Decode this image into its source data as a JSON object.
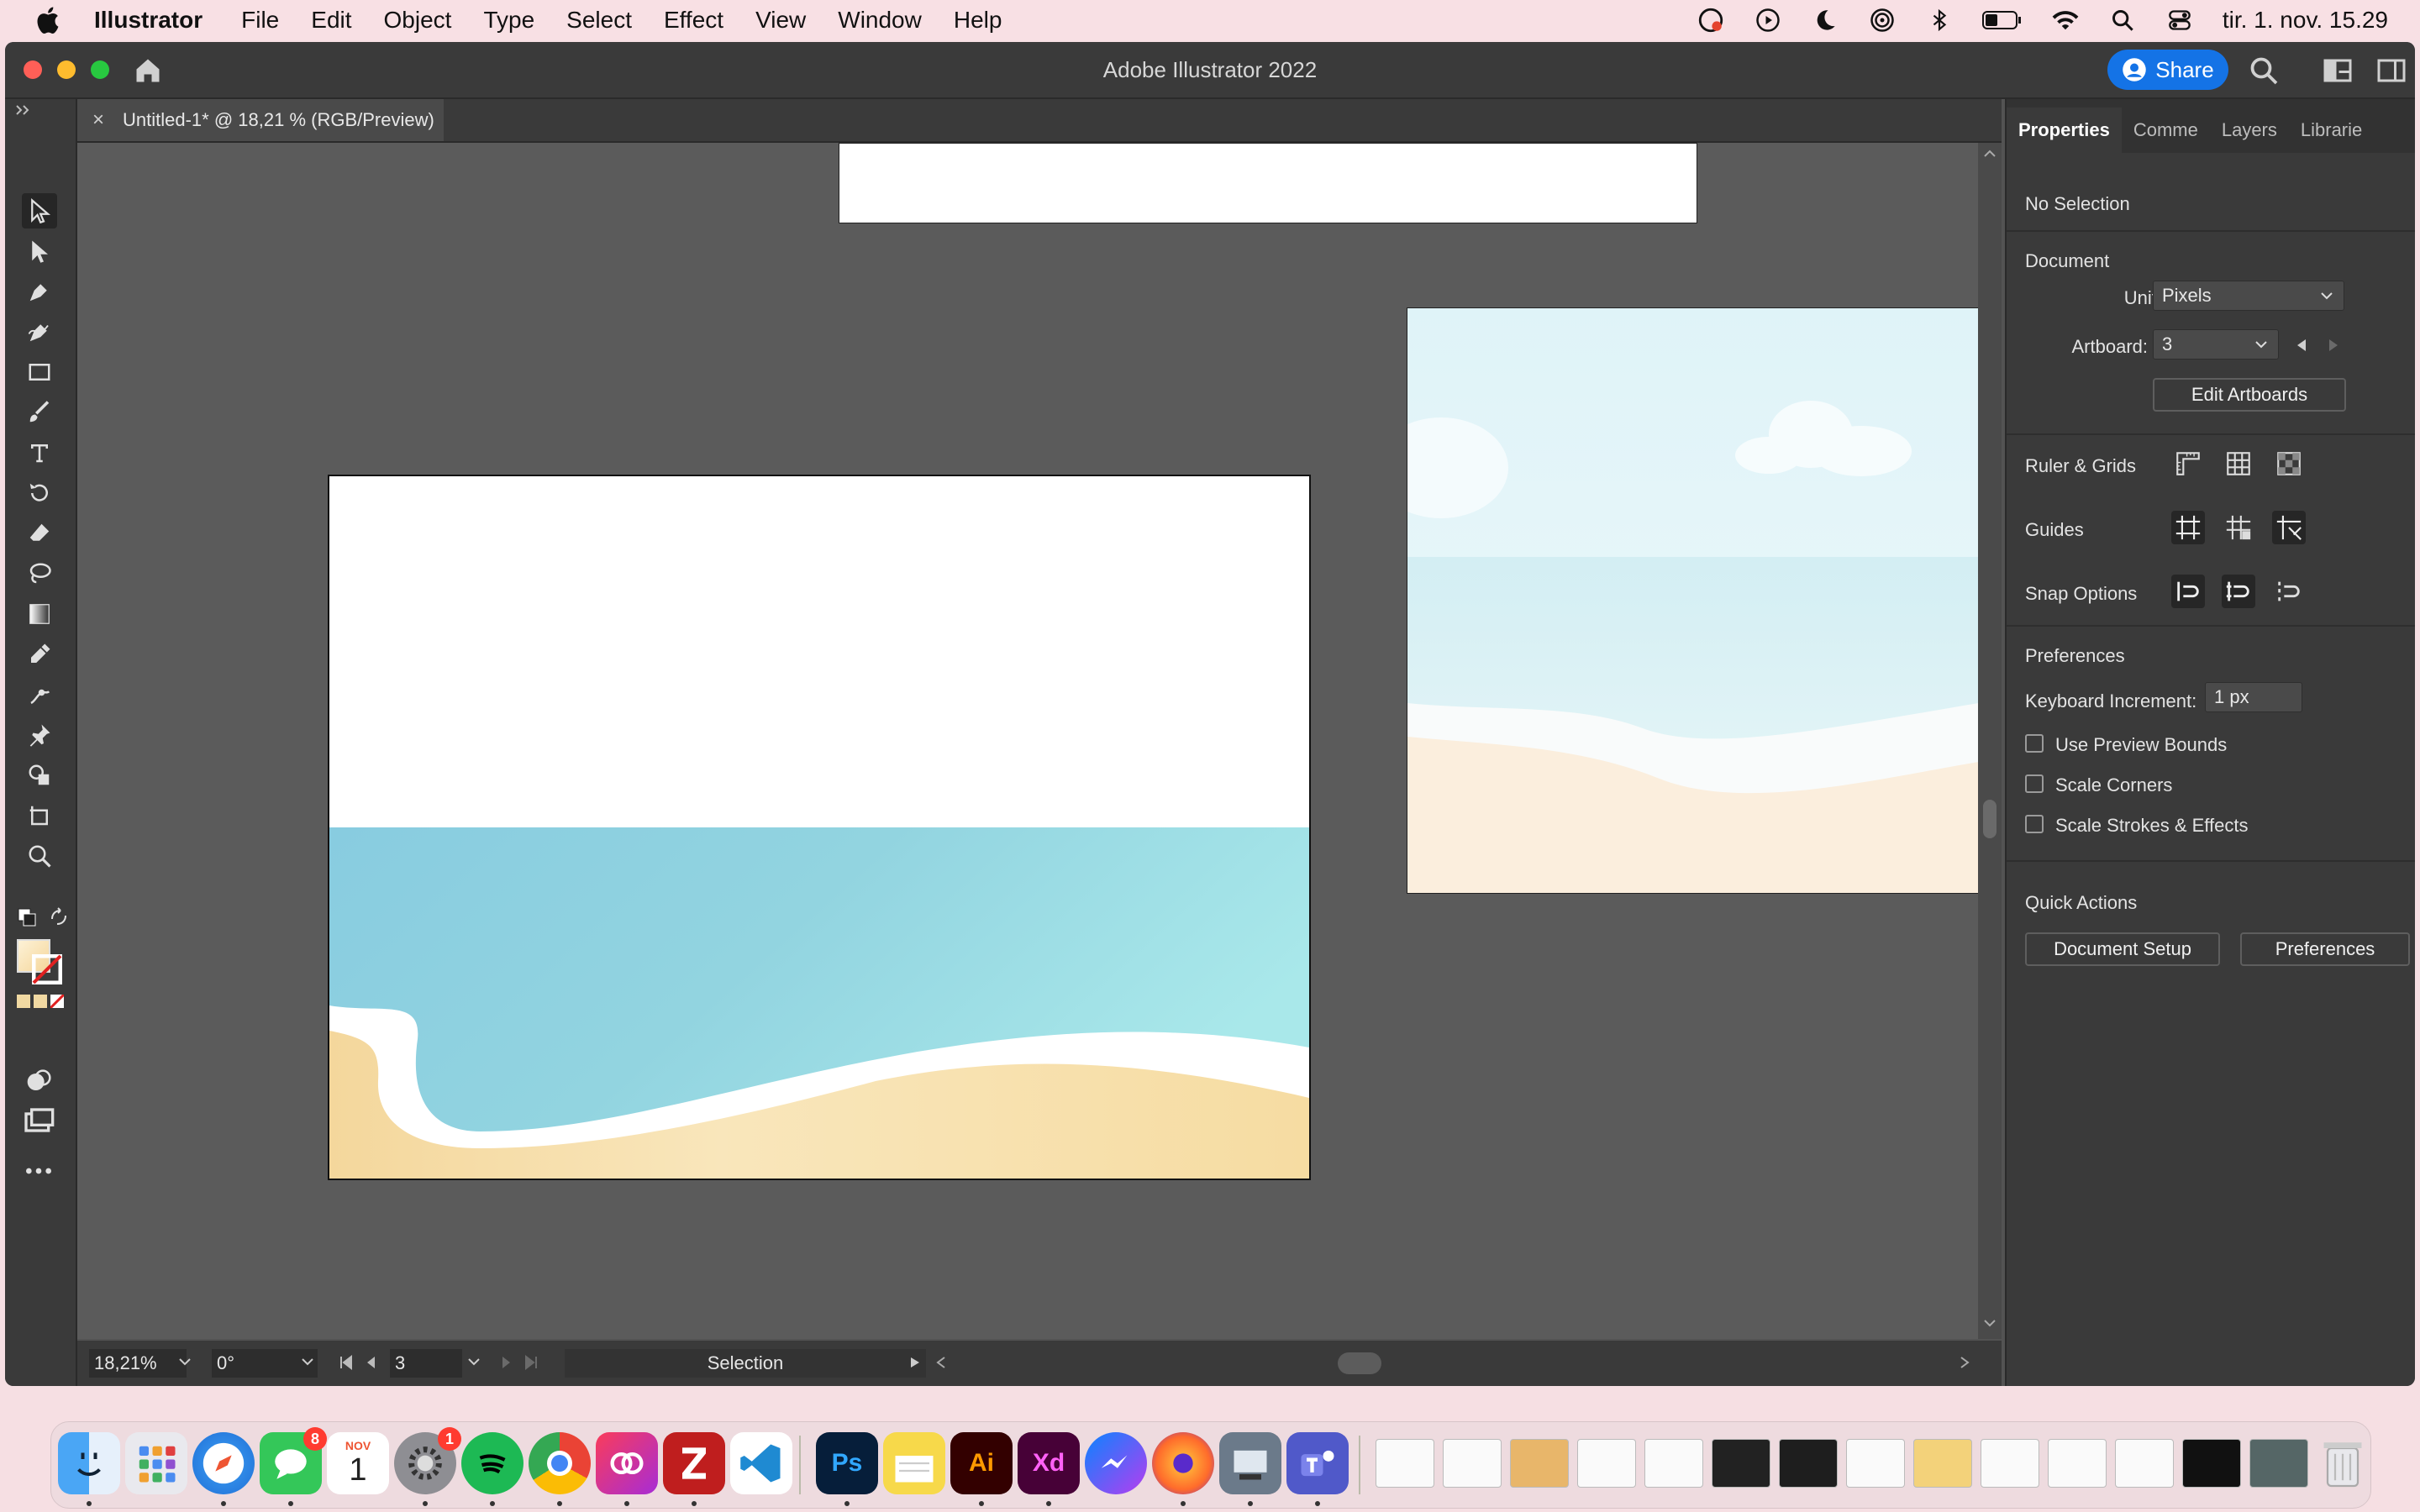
{
  "menubar": {
    "app_name": "Illustrator",
    "items": [
      "File",
      "Edit",
      "Object",
      "Type",
      "Select",
      "Effect",
      "View",
      "Window",
      "Help"
    ],
    "clock": "tir. 1. nov.  15.29"
  },
  "window": {
    "title": "Adobe Illustrator 2022",
    "share_label": "Share"
  },
  "document_tab": {
    "close_glyph": "×",
    "title": "Untitled-1* @ 18,21 % (RGB/Preview)"
  },
  "status_bar": {
    "zoom": "18,21%",
    "rotation": "0°",
    "artboard": "3",
    "tool_name": "Selection"
  },
  "properties": {
    "tabs": [
      "Properties",
      "Comme",
      "Layers",
      "Librarie"
    ],
    "selection_status": "No Selection",
    "document_heading": "Document",
    "units_label": "Units:",
    "units_value": "Pixels",
    "artboard_label": "Artboard:",
    "artboard_value": "3",
    "edit_artboards": "Edit Artboards",
    "ruler_grids": "Ruler & Grids",
    "guides": "Guides",
    "snap_options": "Snap Options",
    "preferences_heading": "Preferences",
    "keyboard_increment_label": "Keyboard Increment:",
    "keyboard_increment_value": "1 px",
    "use_preview_bounds": "Use Preview Bounds",
    "scale_corners": "Scale Corners",
    "scale_strokes": "Scale Strokes & Effects",
    "quick_actions": "Quick Actions",
    "document_setup": "Document Setup",
    "preferences_button": "Preferences"
  },
  "dock": {
    "messages_badge": "8",
    "settings_badge": "1",
    "calendar_month": "NOV",
    "calendar_day": "1",
    "photoshop": "Ps",
    "illustrator": "Ai",
    "xd": "Xd"
  },
  "colors": {
    "accent": "#1473e6",
    "sea_dark": "#86cbdc",
    "sea_light": "#a7e5ea",
    "sand": "#f7dea7"
  }
}
